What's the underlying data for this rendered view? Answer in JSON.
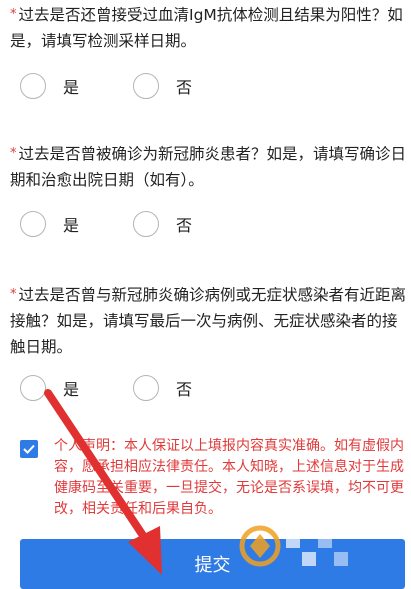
{
  "questions": [
    {
      "text": "过去是否还曾接受过血清IgM抗体检测且结果为阳性？如是，请填写检测采样日期。",
      "options": [
        "是",
        "否"
      ]
    },
    {
      "text": "过去是否曾被确诊为新冠肺炎患者？如是，请填写确诊日期和治愈出院日期（如有）。",
      "options": [
        "是",
        "否"
      ]
    },
    {
      "text": "过去是否曾与新冠肺炎确诊病例或无症状感染者有近距离接触？如是，请填写最后一次与病例、无症状感染者的接触日期。",
      "options": [
        "是",
        "否"
      ]
    }
  ],
  "required_mark": "*",
  "declaration": {
    "checked": true,
    "text": "个人声明：本人保证以上填报内容真实准确。如有虚假内容，愿承担相应法律责任。本人知晓，上述信息对于生成健康码至关重要，一旦提交，无论是否系误填，均不可更改，相关责任和后果自负。"
  },
  "submit_label": "提交",
  "colors": {
    "accent": "#2f7be6",
    "required": "#e03a3a",
    "declaration_text": "#e03a3a",
    "annotation_arrow": "#e03030",
    "watermark": "#f0a020"
  },
  "icons": {
    "annotation": "red-arrow-icon",
    "watermark": "watermark-logo-icon",
    "checkbox": "check-icon"
  }
}
